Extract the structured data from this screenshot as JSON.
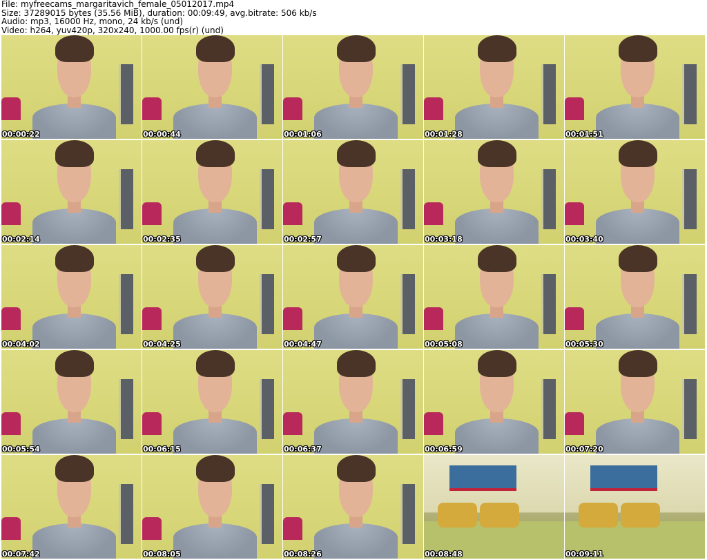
{
  "header": {
    "file_line": "File: myfreecams_margaritavich_female_05012017.mp4",
    "size_line": "Size: 37289015 bytes (35.56 MiB), duration: 00:09:49, avg.bitrate: 506 kb/s",
    "audio_line": "Audio: mp3, 16000 Hz, mono, 24 kb/s (und)",
    "video_line": "Video: h264, yuv420p, 320x240, 1000.00 fps(r) (und)"
  },
  "thumbnails": [
    {
      "timestamp": "00:00:22",
      "scene": "person"
    },
    {
      "timestamp": "00:00:44",
      "scene": "person"
    },
    {
      "timestamp": "00:01:06",
      "scene": "person"
    },
    {
      "timestamp": "00:01:28",
      "scene": "person"
    },
    {
      "timestamp": "00:01:51",
      "scene": "person"
    },
    {
      "timestamp": "00:02:14",
      "scene": "person"
    },
    {
      "timestamp": "00:02:35",
      "scene": "person"
    },
    {
      "timestamp": "00:02:57",
      "scene": "person"
    },
    {
      "timestamp": "00:03:18",
      "scene": "person"
    },
    {
      "timestamp": "00:03:40",
      "scene": "person"
    },
    {
      "timestamp": "00:04:02",
      "scene": "person"
    },
    {
      "timestamp": "00:04:25",
      "scene": "person"
    },
    {
      "timestamp": "00:04:47",
      "scene": "person"
    },
    {
      "timestamp": "00:05:08",
      "scene": "person"
    },
    {
      "timestamp": "00:05:30",
      "scene": "person"
    },
    {
      "timestamp": "00:05:54",
      "scene": "person"
    },
    {
      "timestamp": "00:06:15",
      "scene": "person"
    },
    {
      "timestamp": "00:06:37",
      "scene": "person"
    },
    {
      "timestamp": "00:06:59",
      "scene": "person"
    },
    {
      "timestamp": "00:07:20",
      "scene": "person"
    },
    {
      "timestamp": "00:07:42",
      "scene": "person"
    },
    {
      "timestamp": "00:08:05",
      "scene": "person"
    },
    {
      "timestamp": "00:08:26",
      "scene": "person"
    },
    {
      "timestamp": "00:08:48",
      "scene": "room"
    },
    {
      "timestamp": "00:09:11",
      "scene": "room"
    }
  ],
  "colors": {
    "background": "#ffffff",
    "timestamp_text": "#ffffff",
    "timestamp_outline": "#000000"
  }
}
